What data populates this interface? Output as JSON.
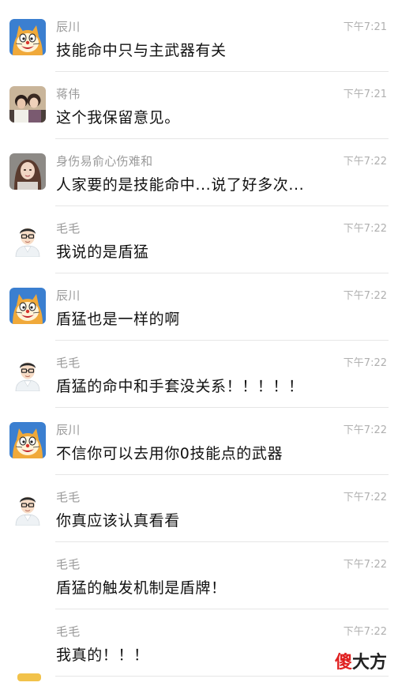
{
  "messages": [
    {
      "avatar": "doraemon-avatar",
      "sender": "辰川",
      "time": "下午7:21",
      "text": "技能命中只与主武器有关"
    },
    {
      "avatar": "photo-avatar-couple",
      "sender": "蒋伟",
      "time": "下午7:21",
      "text": "这个我保留意见。"
    },
    {
      "avatar": "photo-avatar-woman",
      "sender": "身伤易俞心伤难和",
      "time": "下午7:22",
      "text": "人家要的是技能命中...说了好多次..."
    },
    {
      "avatar": "cartoon-man-avatar",
      "sender": "毛毛",
      "time": "下午7:22",
      "text": "我说的是盾猛"
    },
    {
      "avatar": "doraemon-avatar",
      "sender": "辰川",
      "time": "下午7:22",
      "text": "盾猛也是一样的啊"
    },
    {
      "avatar": "cartoon-man-avatar",
      "sender": "毛毛",
      "time": "下午7:22",
      "text": "盾猛的命中和手套没关系！！！！！"
    },
    {
      "avatar": "doraemon-avatar",
      "sender": "辰川",
      "time": "下午7:22",
      "text": "不信你可以去用你0技能点的武器"
    },
    {
      "avatar": "cartoon-man-avatar",
      "sender": "毛毛",
      "time": "下午7:22",
      "text": "你真应该认真看看"
    },
    {
      "avatar": "",
      "sender": "毛毛",
      "time": "下午7:22",
      "text": "盾猛的触发机制是盾牌！"
    },
    {
      "avatar": "",
      "sender": "毛毛",
      "time": "下午7:22",
      "text": "我真的！！！"
    }
  ],
  "watermark": {
    "part1": "傻",
    "part2": "大方"
  },
  "colors": {
    "divider": "#e6e6e6",
    "sender": "#9a9a9a",
    "time": "#b0b0b0",
    "text": "#111111",
    "watermark_red": "#e02020"
  }
}
